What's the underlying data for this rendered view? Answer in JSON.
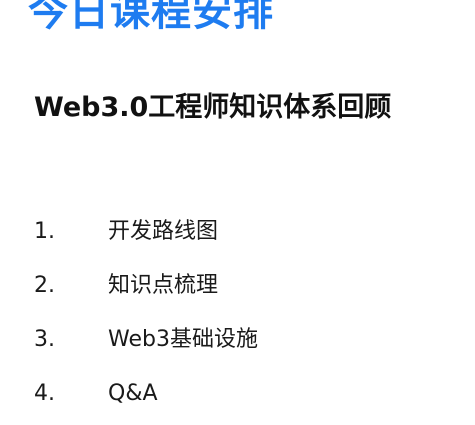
{
  "header": {
    "title": "今日课程安排",
    "title_color": "#1e7cf0"
  },
  "subtitle": {
    "text": "Web3.0工程师知识体系回顾",
    "color": "#111111"
  },
  "agenda": {
    "text_color": "#1a1a1a",
    "items": [
      {
        "number": "1.",
        "label": "开发路线图"
      },
      {
        "number": "2.",
        "label": "知识点梳理"
      },
      {
        "number": "3.",
        "label": "Web3基础设施"
      },
      {
        "number": "4.",
        "label": "Q&A"
      }
    ]
  }
}
